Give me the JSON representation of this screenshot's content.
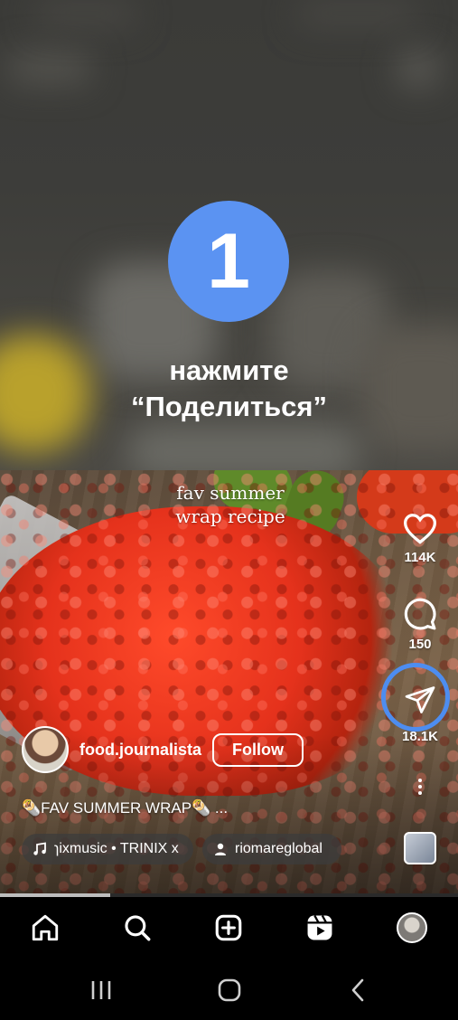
{
  "tutorial": {
    "step_number": "1",
    "instruction_line1": "нажмите",
    "instruction_line2": "“Поделиться”"
  },
  "video": {
    "overlay_caption_line1": "fav summer",
    "overlay_caption_line2": "wrap recipe",
    "likes": "114K",
    "comments": "150",
    "shares": "18.1K",
    "author": "food.journalista",
    "follow_label": "Follow",
    "description": "🌯FAV SUMMER WRAP🌯 ...",
    "music_label": "ɿixmusic • TRINIX x",
    "tagged_user": "riomareglobal",
    "progress_fraction": 0.24
  },
  "icons": {
    "like": "heart-icon",
    "comment": "comment-icon",
    "share": "paper-plane-icon",
    "more": "more-vertical-icon",
    "music": "music-note-icon",
    "user": "person-icon",
    "nav_home": "home-icon",
    "nav_search": "search-icon",
    "nav_create": "plus-square-icon",
    "nav_reels": "reels-icon",
    "sys_recents": "recents-icon",
    "sys_home": "home-circle-icon",
    "sys_back": "back-chevron-icon"
  },
  "colors": {
    "step_badge": "#5b93f2",
    "share_highlight": "#4d8df0",
    "nav_background": "#000000"
  }
}
